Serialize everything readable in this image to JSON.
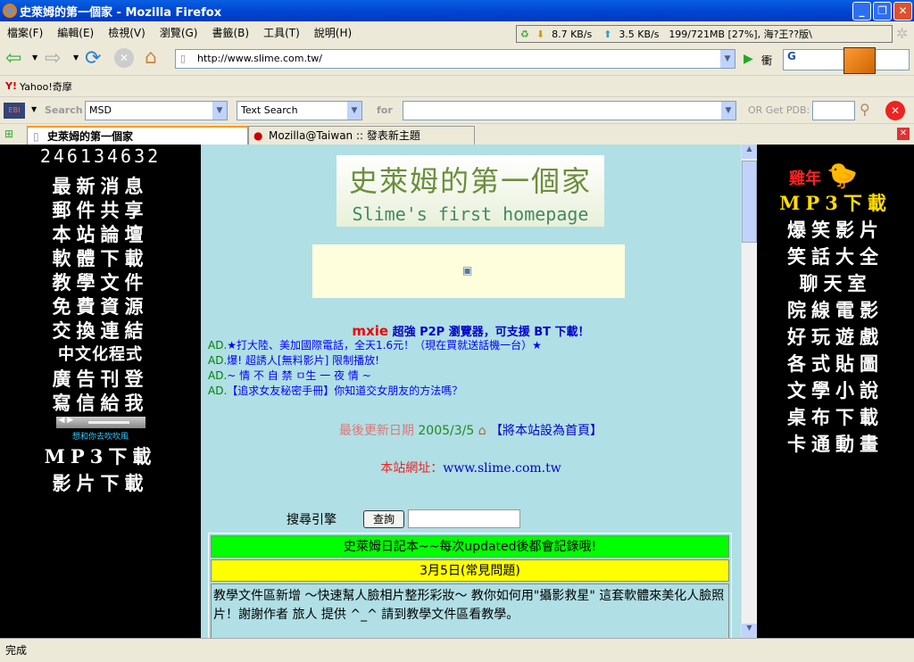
{
  "window": {
    "title": "史萊姆的第一個家 - Mozilla Firefox"
  },
  "menu": [
    "檔案(F)",
    "編輯(E)",
    "檢視(V)",
    "瀏覽(G)",
    "書籤(B)",
    "工具(T)",
    "說明(H)"
  ],
  "transfer": {
    "down": "8.7 KB/s",
    "up": "3.5 KB/s",
    "memory": "199/721MB [27%], 海?王??版\\"
  },
  "nav": {
    "url": "http://www.slime.com.tw/",
    "go_label": "衝",
    "search_engine": "G"
  },
  "bookmarks": [
    {
      "label": "Yahoo!奇摩"
    }
  ],
  "ebi": {
    "search_label": "Search",
    "db": "MSD",
    "mode": "Text Search",
    "for_label": "for",
    "for_value": "",
    "pdb_label": "OR Get PDB:"
  },
  "tabs": [
    {
      "label": "史萊姆的第一個家",
      "active": true
    },
    {
      "label": "Mozilla@Taiwan :: 發表新主題",
      "active": false
    }
  ],
  "left": {
    "counter": "246134632",
    "items": [
      "最新消息",
      "郵件共享",
      "本站論壇",
      "軟體下載",
      "教學文件",
      "免費資源",
      "交換連結",
      "中文化程式",
      "廣告刊登",
      "寫信給我"
    ],
    "song": "想和你去吹吹風",
    "items2": [
      "MP3下載",
      "影片下載"
    ]
  },
  "right": {
    "badge": "雞年",
    "items": [
      "MP3下載",
      "爆笑影片",
      "笑話大全",
      "聊天室",
      "院線電影",
      "好玩遊戲",
      "各式貼圖",
      "文學小說",
      "桌布下載",
      "卡通動畫"
    ]
  },
  "center": {
    "logo_line1": "史萊姆的第一個家",
    "logo_line2": "Slime's first homepage",
    "promo_brand": "mxie",
    "promo_text": " 超強 P2P 瀏覽器，可支援 BT 下載！",
    "ads": [
      {
        "prefix": "AD.",
        "text": "★打大陸、美加國際電話，全天1.6元！（現在買就送話機一台）★"
      },
      {
        "prefix": "AD.",
        "text": "爆! 超誘人[無料影片] 限制播放!"
      },
      {
        "prefix": "AD.",
        "text": "~ 情 不 自 禁 ㅁ生 一 夜 情 ~"
      },
      {
        "prefix": "AD.",
        "text": "【追求女友秘密手冊】你知道交女朋友的方法嗎？"
      }
    ],
    "updated_label": "最後更新日期",
    "updated_date": "2005/3/5",
    "set_home": "【將本站設為首頁】",
    "site_label": "本站網址：",
    "site_url": "www.slime.com.tw",
    "search_label": "搜尋引擎",
    "search_button": "查詢",
    "search_value": "",
    "diary_title": "史萊姆日記本~~每次updated後都會記錄哦!",
    "entry_date": "3月5日(常見問題)",
    "entry_text": "教學文件區新增 ～快速幫人臉相片整形彩妝～ 教你如何用\"攝影救星\" 這套軟體來美化人臉照片！謝謝作者 旅人 提供 ^_^ 請到教學文件區看教學。"
  },
  "status": "完成"
}
